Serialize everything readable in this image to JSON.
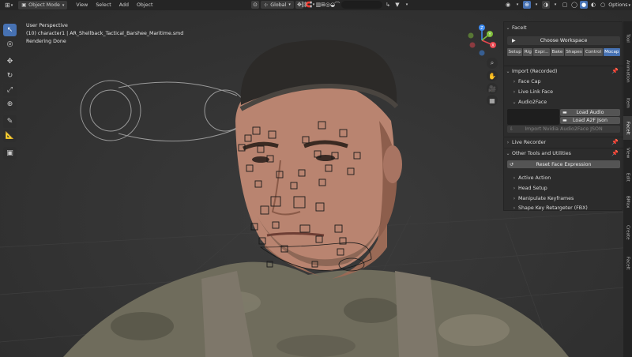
{
  "header": {
    "blender_icon": "blender-logo-icon",
    "mode": "Object Mode",
    "menus": [
      "View",
      "Select",
      "Add",
      "Object"
    ],
    "transform_orientation": "Global",
    "options_label": "Options"
  },
  "viewport": {
    "perspective": "User Perspective",
    "object_info": "(10) character1 | AR_Shellback_Tactical_Barshee_Maritime.smd",
    "status": "Rendering Done",
    "gizmo_axes": {
      "x": "X",
      "y": "Y",
      "z": "Z"
    }
  },
  "npanel": {
    "title": "FaceIt",
    "choose_workspace": "Choose Workspace",
    "tabs": [
      "Setup",
      "Rig",
      "Expr...",
      "Bake",
      "Shapes",
      "Control",
      "Mocap"
    ],
    "active_tab": "Mocap",
    "import_section": "Import (Recorded)",
    "face_cap": "Face Cap",
    "live_link_face": "Live Link Face",
    "audio2face": "Audio2Face",
    "load_audio": "Load Audio",
    "load_a2f_json": "Load A2F Json",
    "import_nvidia": "Import Nvidia Audio2Face JSON",
    "live_recorder": "Live Recorder",
    "other_tools": "Other Tools and Utilities",
    "reset_face_expression": "Reset Face Expression",
    "active_action": "Active Action",
    "head_setup": "Head Setup",
    "manipulate_keyframes": "Manipulate Keyframes",
    "shape_key_retargeter": "Shape Key Retargeter (FBX)"
  },
  "side_tabs": [
    "Tool",
    "Animation",
    "Item",
    "FaceIt",
    "View",
    "Edit",
    "BMax",
    "Create",
    "FaceIt"
  ],
  "colors": {
    "accent": "#4772b3",
    "x_axis": "#e8464f",
    "y_axis": "#7fbe3a",
    "z_axis": "#3e8cf2"
  }
}
